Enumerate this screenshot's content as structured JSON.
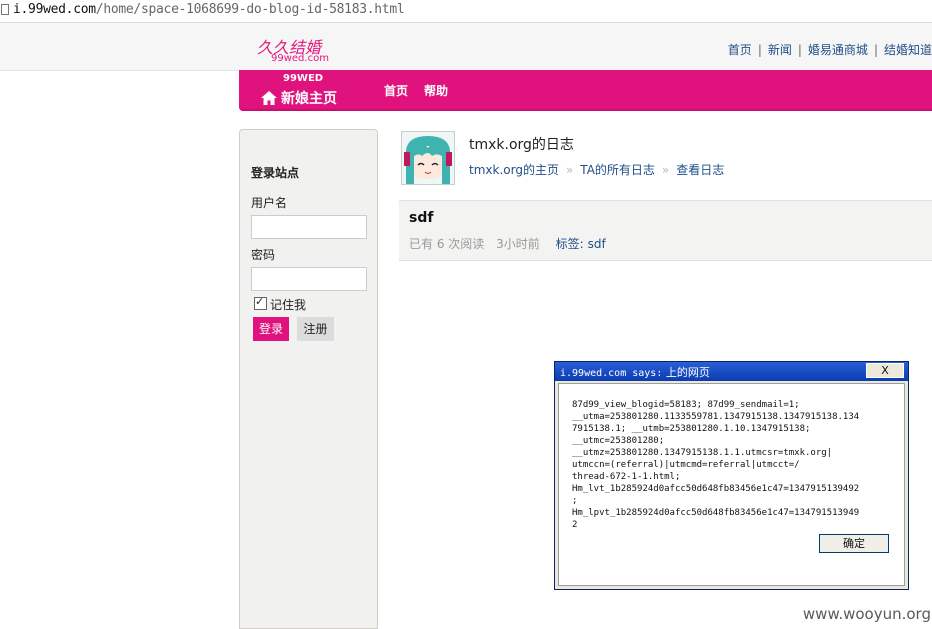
{
  "browser": {
    "url_domain": "i.99wed.com",
    "url_path": "/home/space-1068699-do-blog-id-58183.html"
  },
  "site": {
    "logo_cn": "久久结婚",
    "logo_en": "99wed.com",
    "brand_color": "#e0127d"
  },
  "top_nav": {
    "items": [
      "首页",
      "新闻",
      "婚易通商城",
      "结婚知道"
    ],
    "separator": "|"
  },
  "pink_bar": {
    "brand_top": "99WED",
    "brand_title": "新娘主页",
    "nav": [
      "首页",
      "帮助"
    ]
  },
  "sidebar": {
    "title": "登录站点",
    "username_label": "用户名",
    "username_value": "",
    "password_label": "密码",
    "password_value": "",
    "remember_label": "记住我",
    "remember_checked": true,
    "login_button": "登录",
    "register_button": "注册"
  },
  "blog_header": {
    "title": "tmxk.org的日志",
    "breadcrumbs": [
      "tmxk.org的主页",
      "TA的所有日志",
      "查看日志"
    ],
    "breadcrumb_separator": "»"
  },
  "post": {
    "title": "sdf",
    "read_count_text": "已有 6 次阅读",
    "time_text": "3小时前",
    "tag_label": "标签:",
    "tag_value": "sdf"
  },
  "dialog": {
    "title_domain": "i.99wed.com says:",
    "title_suffix": "上的网页",
    "close_label": "X",
    "message": "87d99_view_blogid=58183; 87d99_sendmail=1;\n__utma=253801280.1133559781.1347915138.1347915138.134\n7915138.1; __utmb=253801280.1.10.1347915138;\n__utmc=253801280;\n__utmz=253801280.1347915138.1.1.utmcsr=tmxk.org|\nutmccn=(referral)|utmcmd=referral|utmcct=/\nthread-672-1-1.html;\nHm_lvt_1b285924d0afcc50d648fb83456e1c47=1347915139492\n;\nHm_lpvt_1b285924d0afcc50d648fb83456e1c47=134791513949\n2",
    "ok_label": "确定"
  },
  "watermark": "www.wooyun.org"
}
